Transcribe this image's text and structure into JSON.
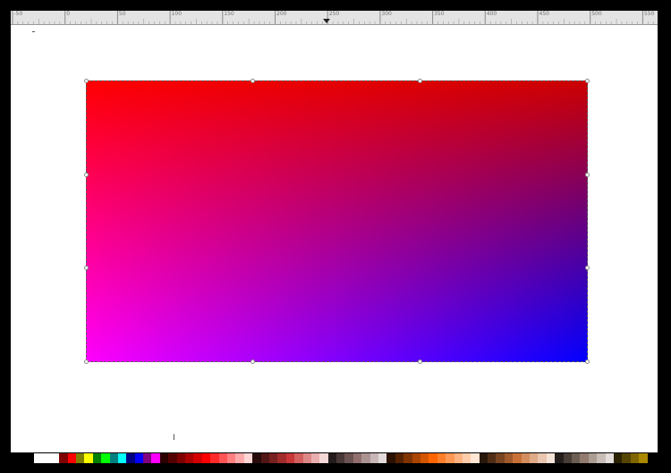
{
  "ruler": {
    "labels": [
      "-50",
      "0",
      "50",
      "100",
      "150",
      "200",
      "250",
      "300",
      "350",
      "400",
      "450",
      "500",
      "550"
    ]
  },
  "canvas": {
    "background": "#ffffff",
    "gradient": {
      "top_left": "#ff0000",
      "top_right": "#cc0000",
      "bottom_left": "#ff00ff",
      "bottom_right": "#0000ff"
    }
  },
  "cursor_label": "I",
  "palette": {
    "colors": [
      "#ffffff",
      "#ffffff",
      "#ffffff",
      "#800000",
      "#ff0000",
      "#808000",
      "#ffff00",
      "#008000",
      "#00ff00",
      "#008080",
      "#00ffff",
      "#000080",
      "#0000ff",
      "#800080",
      "#ff00ff",
      "#2b0000",
      "#550000",
      "#800000",
      "#aa0000",
      "#d40000",
      "#ff0000",
      "#ff2a2a",
      "#ff5555",
      "#ff8080",
      "#ffaaaa",
      "#ffd5d5",
      "#280b0b",
      "#501616",
      "#782121",
      "#a02c2c",
      "#c83737",
      "#d35f5f",
      "#de8787",
      "#e9afaf",
      "#f4d7d7",
      "#241c1c",
      "#483737",
      "#6c5353",
      "#916f6f",
      "#ac9393",
      "#c8b7b7",
      "#e3dbdb",
      "#2b1100",
      "#552200",
      "#803300",
      "#aa4400",
      "#d45500",
      "#ff6600",
      "#ff7f2a",
      "#ff9955",
      "#ffb380",
      "#ffccaa",
      "#ffe6d5",
      "#28170b",
      "#502d16",
      "#784421",
      "#a05a2c",
      "#c87137",
      "#d38d5f",
      "#deaa87",
      "#e9c6af",
      "#f4e3d7",
      "#241f1c",
      "#483e37",
      "#6c5d53",
      "#917c6f",
      "#ac9d93",
      "#c8beb7",
      "#e3dedb",
      "#2b2200",
      "#554400",
      "#806600",
      "#aa8800"
    ]
  }
}
